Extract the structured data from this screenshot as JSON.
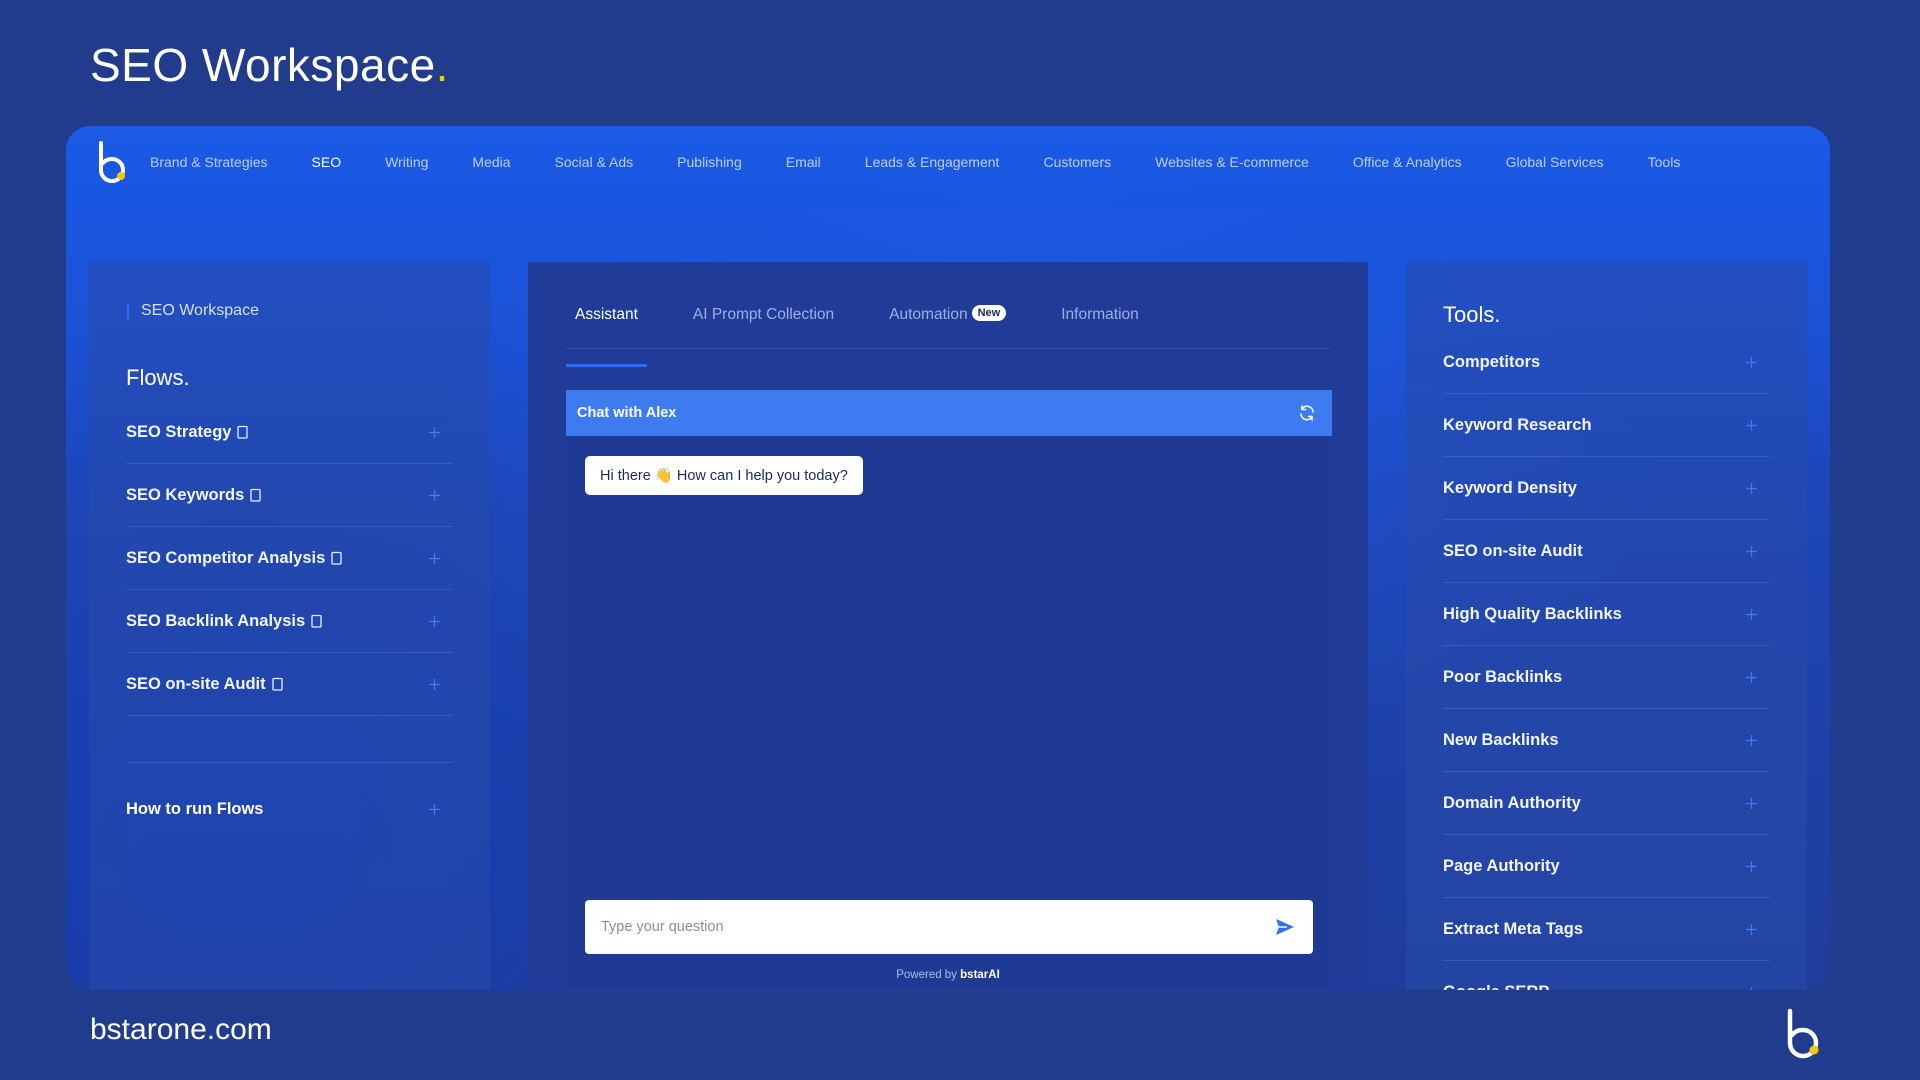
{
  "slide": {
    "title": "SEO Workspace",
    "title_dot": ".",
    "footer_domain": "bstarone.com"
  },
  "nav": {
    "items": [
      {
        "label": "Brand & Strategies",
        "active": false
      },
      {
        "label": "SEO",
        "active": true
      },
      {
        "label": "Writing",
        "active": false
      },
      {
        "label": "Media",
        "active": false
      },
      {
        "label": "Social & Ads",
        "active": false
      },
      {
        "label": "Publishing",
        "active": false
      },
      {
        "label": "Email",
        "active": false
      },
      {
        "label": "Leads & Engagement",
        "active": false
      },
      {
        "label": "Customers",
        "active": false
      },
      {
        "label": "Websites & E-commerce",
        "active": false
      },
      {
        "label": "Office & Analytics",
        "active": false
      },
      {
        "label": "Global Services",
        "active": false
      },
      {
        "label": "Tools",
        "active": false
      }
    ]
  },
  "left": {
    "breadcrumb": "SEO Workspace",
    "heading": "Flows.",
    "flows": [
      {
        "label": "SEO Strategy",
        "icon": "copy-icon"
      },
      {
        "label": "SEO Keywords",
        "icon": "copy-icon"
      },
      {
        "label": "SEO Competitor Analysis",
        "icon": "copy-icon"
      },
      {
        "label": "SEO Backlink Analysis",
        "icon": "copy-icon"
      },
      {
        "label": "SEO on-site Audit",
        "icon": "copy-icon"
      }
    ],
    "how_to": "How to run Flows"
  },
  "center": {
    "tabs": [
      {
        "label": "Assistant",
        "active": true
      },
      {
        "label": "AI Prompt Collection",
        "active": false
      },
      {
        "label": "Automation",
        "active": false,
        "badge": "New"
      },
      {
        "label": "Information",
        "active": false
      }
    ],
    "chat_title": "Chat with Alex",
    "greeting": "Hi there 👋 How can I help you today?",
    "input_placeholder": "Type your question",
    "powered_prefix": "Powered by ",
    "powered_brand": "bstarAI"
  },
  "right": {
    "heading": "Tools.",
    "tools": [
      "Competitors",
      "Keyword Research",
      "Keyword Density",
      "SEO on-site Audit",
      "High Quality Backlinks",
      "Poor Backlinks",
      "New Backlinks",
      "Domain Authority",
      "Page Authority",
      "Extract Meta Tags",
      "Google SERP"
    ]
  },
  "colors": {
    "background": "#213c8c",
    "accent": "#3f7bf0",
    "logo_dot": "#f5c518"
  }
}
